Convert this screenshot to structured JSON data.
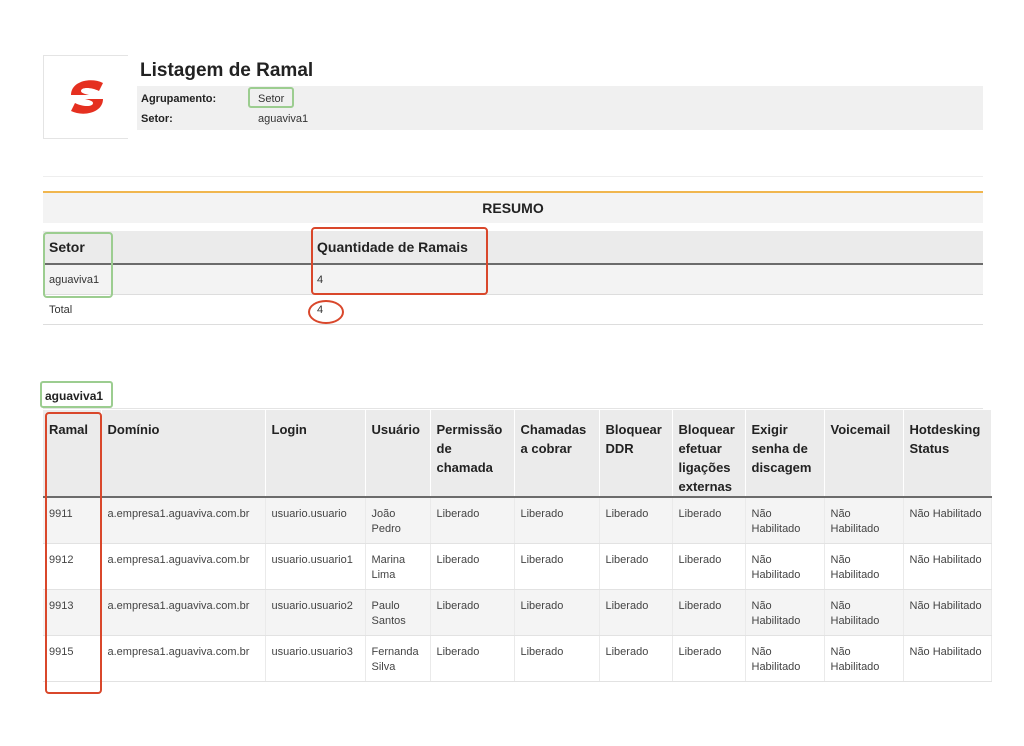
{
  "header": {
    "title": "Listagem de Ramal",
    "fields": [
      {
        "label": "Agrupamento:",
        "value": "Setor"
      },
      {
        "label": "Setor:",
        "value": "aguaviva1"
      }
    ]
  },
  "summary": {
    "title": "RESUMO",
    "columns": [
      "Setor",
      "Quantidade de Ramais"
    ],
    "rows": [
      {
        "setor": "aguaviva1",
        "quantidade": "4"
      }
    ],
    "total": {
      "label": "Total",
      "value": "4"
    }
  },
  "group": {
    "name": "aguaviva1",
    "columns": [
      "Ramal",
      "Domínio",
      "Login",
      "Usuário",
      "Permissão de chamada",
      "Chamadas a cobrar",
      "Bloquear DDR",
      "Bloquear efetuar ligações externas",
      "Exigir senha de discagem",
      "Voicemail",
      "Hotdesking Status"
    ],
    "rows": [
      [
        "9911",
        "a.empresa1.aguaviva.com.br",
        "usuario.usuario",
        "João Pedro",
        "Liberado",
        "Liberado",
        "Liberado",
        "Liberado",
        "Não Habilitado",
        "Não Habilitado",
        "Não Habilitado"
      ],
      [
        "9912",
        "a.empresa1.aguaviva.com.br",
        "usuario.usuario1",
        "Marina Lima",
        "Liberado",
        "Liberado",
        "Liberado",
        "Liberado",
        "Não Habilitado",
        "Não Habilitado",
        "Não Habilitado"
      ],
      [
        "9913",
        "a.empresa1.aguaviva.com.br",
        "usuario.usuario2",
        "Paulo Santos",
        "Liberado",
        "Liberado",
        "Liberado",
        "Liberado",
        "Não Habilitado",
        "Não Habilitado",
        "Não Habilitado"
      ],
      [
        "9915",
        "a.empresa1.aguaviva.com.br",
        "usuario.usuario3",
        "Fernanda Silva",
        "Liberado",
        "Liberado",
        "Liberado",
        "Liberado",
        "Não Habilitado",
        "Não Habilitado",
        "Não Habilitado"
      ]
    ]
  },
  "colors": {
    "brand": "#e53020",
    "accent_rule": "#f0b64e",
    "highlight_green": "#9ccd90",
    "highlight_red": "#d9472b"
  },
  "icons": {
    "logo": "brand-logo-s"
  }
}
